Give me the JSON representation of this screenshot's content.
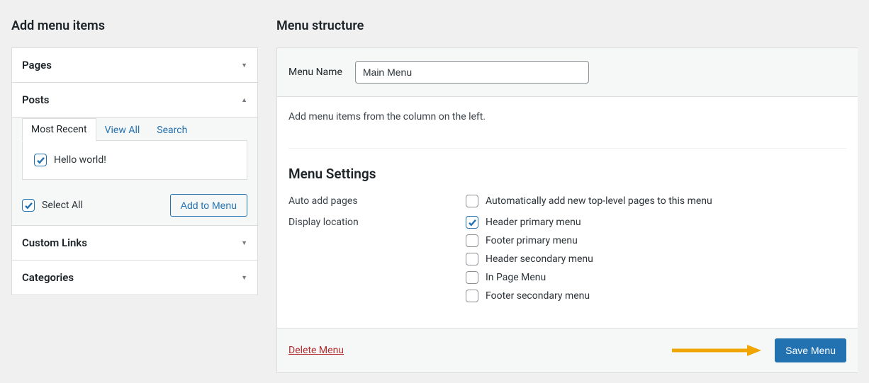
{
  "left": {
    "heading": "Add menu items",
    "panels": {
      "pages": {
        "title": "Pages"
      },
      "posts": {
        "title": "Posts",
        "tabs": {
          "recent": "Most Recent",
          "view_all": "View All",
          "search": "Search"
        },
        "items": [
          {
            "label": "Hello world!",
            "checked": true
          }
        ],
        "select_all": "Select All",
        "select_all_checked": true,
        "add_btn": "Add to Menu"
      },
      "custom_links": {
        "title": "Custom Links"
      },
      "categories": {
        "title": "Categories"
      }
    }
  },
  "right": {
    "heading": "Menu structure",
    "menu_name_label": "Menu Name",
    "menu_name_value": "Main Menu",
    "hint": "Add menu items from the column on the left.",
    "settings_title": "Menu Settings",
    "auto_add_label": "Auto add pages",
    "auto_add_option": "Automatically add new top-level pages to this menu",
    "auto_add_checked": false,
    "display_label": "Display location",
    "locations": [
      {
        "label": "Header primary menu",
        "checked": true
      },
      {
        "label": "Footer primary menu",
        "checked": false
      },
      {
        "label": "Header secondary menu",
        "checked": false
      },
      {
        "label": "In Page Menu",
        "checked": false
      },
      {
        "label": "Footer secondary menu",
        "checked": false
      }
    ],
    "delete": "Delete Menu",
    "save": "Save Menu"
  }
}
